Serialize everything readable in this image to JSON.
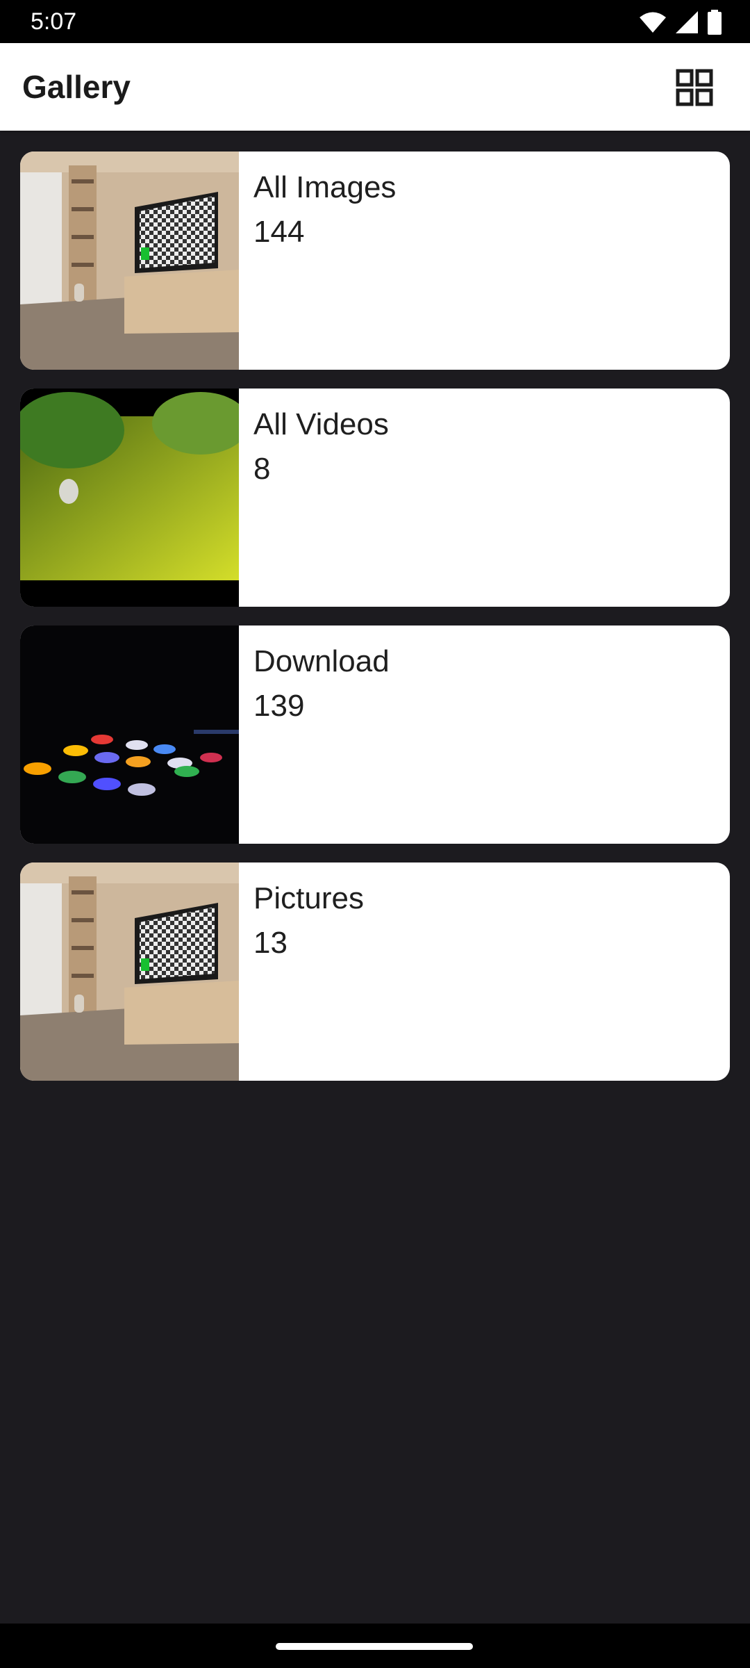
{
  "status_bar": {
    "time": "5:07",
    "icons": [
      "wifi-icon",
      "cellular-signal-icon",
      "battery-icon"
    ]
  },
  "app_bar": {
    "title": "Gallery",
    "action_icon": "grid-view-icon"
  },
  "albums": [
    {
      "name": "All Images",
      "count": "144",
      "thumbnail": "living-room-tv"
    },
    {
      "name": "All Videos",
      "count": "8",
      "thumbnail": "bunny-on-grass"
    },
    {
      "name": "Download",
      "count": "139",
      "thumbnail": "app-icons-dark"
    },
    {
      "name": "Pictures",
      "count": "13",
      "thumbnail": "living-room-tv"
    }
  ],
  "colors": {
    "background": "#1c1b1f",
    "app_bar": "#ffffff",
    "card": "#ffffff",
    "text": "#1f1f1f"
  }
}
